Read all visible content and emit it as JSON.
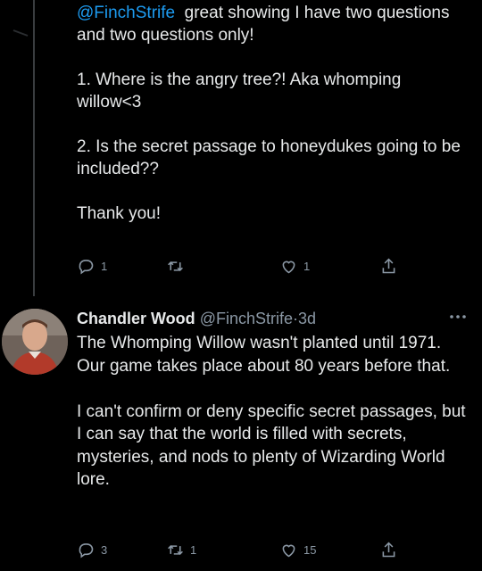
{
  "tweet1": {
    "mention": "@FinchStrife",
    "text_after_mention": "  great showing I have two questions and two questions only!\n\n1. Where is the angry tree?! Aka whomping willow<3\n\n2. Is the secret passage to honeydukes going to be included??\n\nThank you!",
    "reply_count": "1",
    "retweet_count": "",
    "like_count": "1"
  },
  "tweet2": {
    "name": "Chandler Wood",
    "handle": "@FinchStrife",
    "separator": "·",
    "time": "3d",
    "text": "The Whomping Willow wasn't planted until 1971. Our game takes place about 80 years before that.\n\nI can't confirm or deny specific secret passages, but I can say that the world is filled with secrets, mysteries, and nods to plenty of Wizarding World lore.",
    "reply_count": "3",
    "retweet_count": "1",
    "like_count": "15"
  },
  "icons": [
    "reply-icon",
    "retweet-icon",
    "like-icon",
    "share-icon",
    "more-icon"
  ],
  "colors": {
    "background": "#000000",
    "text": "#e7e9ea",
    "muted": "#8b98a5",
    "link": "#1d9bf0"
  }
}
